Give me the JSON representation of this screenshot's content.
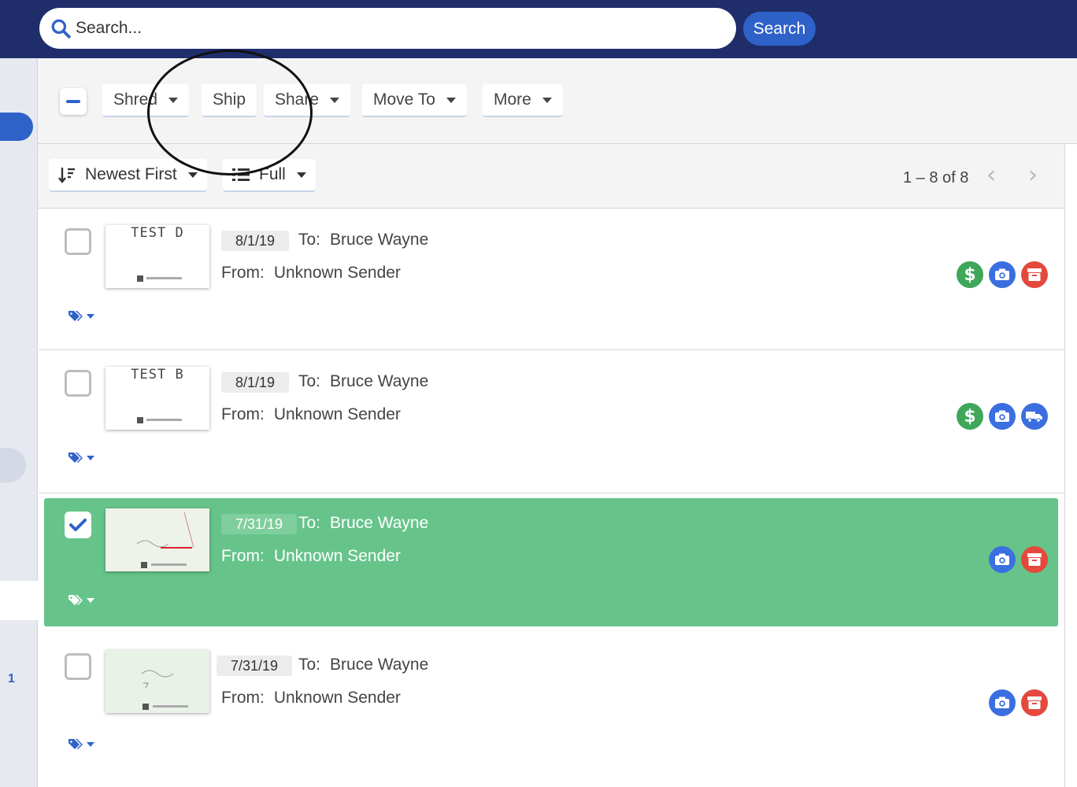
{
  "search": {
    "placeholder": "Search...",
    "button_label": "Search"
  },
  "rail": {
    "page_number": "1"
  },
  "toolbar": {
    "shred_label": "Shred",
    "ship_label": "Ship",
    "share_label": "Share",
    "move_label": "Move To",
    "more_label": "More"
  },
  "sort": {
    "order_label": "Newest First",
    "view_label": "Full",
    "pager_text": "1 – 8 of 8"
  },
  "labels": {
    "to": "To:",
    "from": "From:"
  },
  "rows": [
    {
      "thumb_label": "TEST D",
      "date": "8/1/19",
      "to": "Bruce Wayne",
      "from": "Unknown Sender",
      "selected": false,
      "icons": [
        "dollar-icon",
        "camera-icon",
        "archive-icon"
      ]
    },
    {
      "thumb_label": "TEST B",
      "date": "8/1/19",
      "to": "Bruce Wayne",
      "from": "Unknown Sender",
      "selected": false,
      "icons": [
        "dollar-icon",
        "camera-icon",
        "truck-icon"
      ]
    },
    {
      "thumb_label": "",
      "date": "7/31/19",
      "to": "Bruce Wayne",
      "from": "Unknown Sender",
      "selected": true,
      "icons": [
        "camera-icon",
        "archive-icon"
      ]
    },
    {
      "thumb_label": "",
      "date": "7/31/19",
      "to": "Bruce Wayne",
      "from": "Unknown Sender",
      "selected": false,
      "icons": [
        "camera-icon",
        "archive-icon"
      ]
    }
  ],
  "colors": {
    "header": "#1f2e6b",
    "accent": "#2f62c9",
    "selected_row": "#66c48a",
    "green_icon": "#3ea75a",
    "red_icon": "#e5483d"
  }
}
